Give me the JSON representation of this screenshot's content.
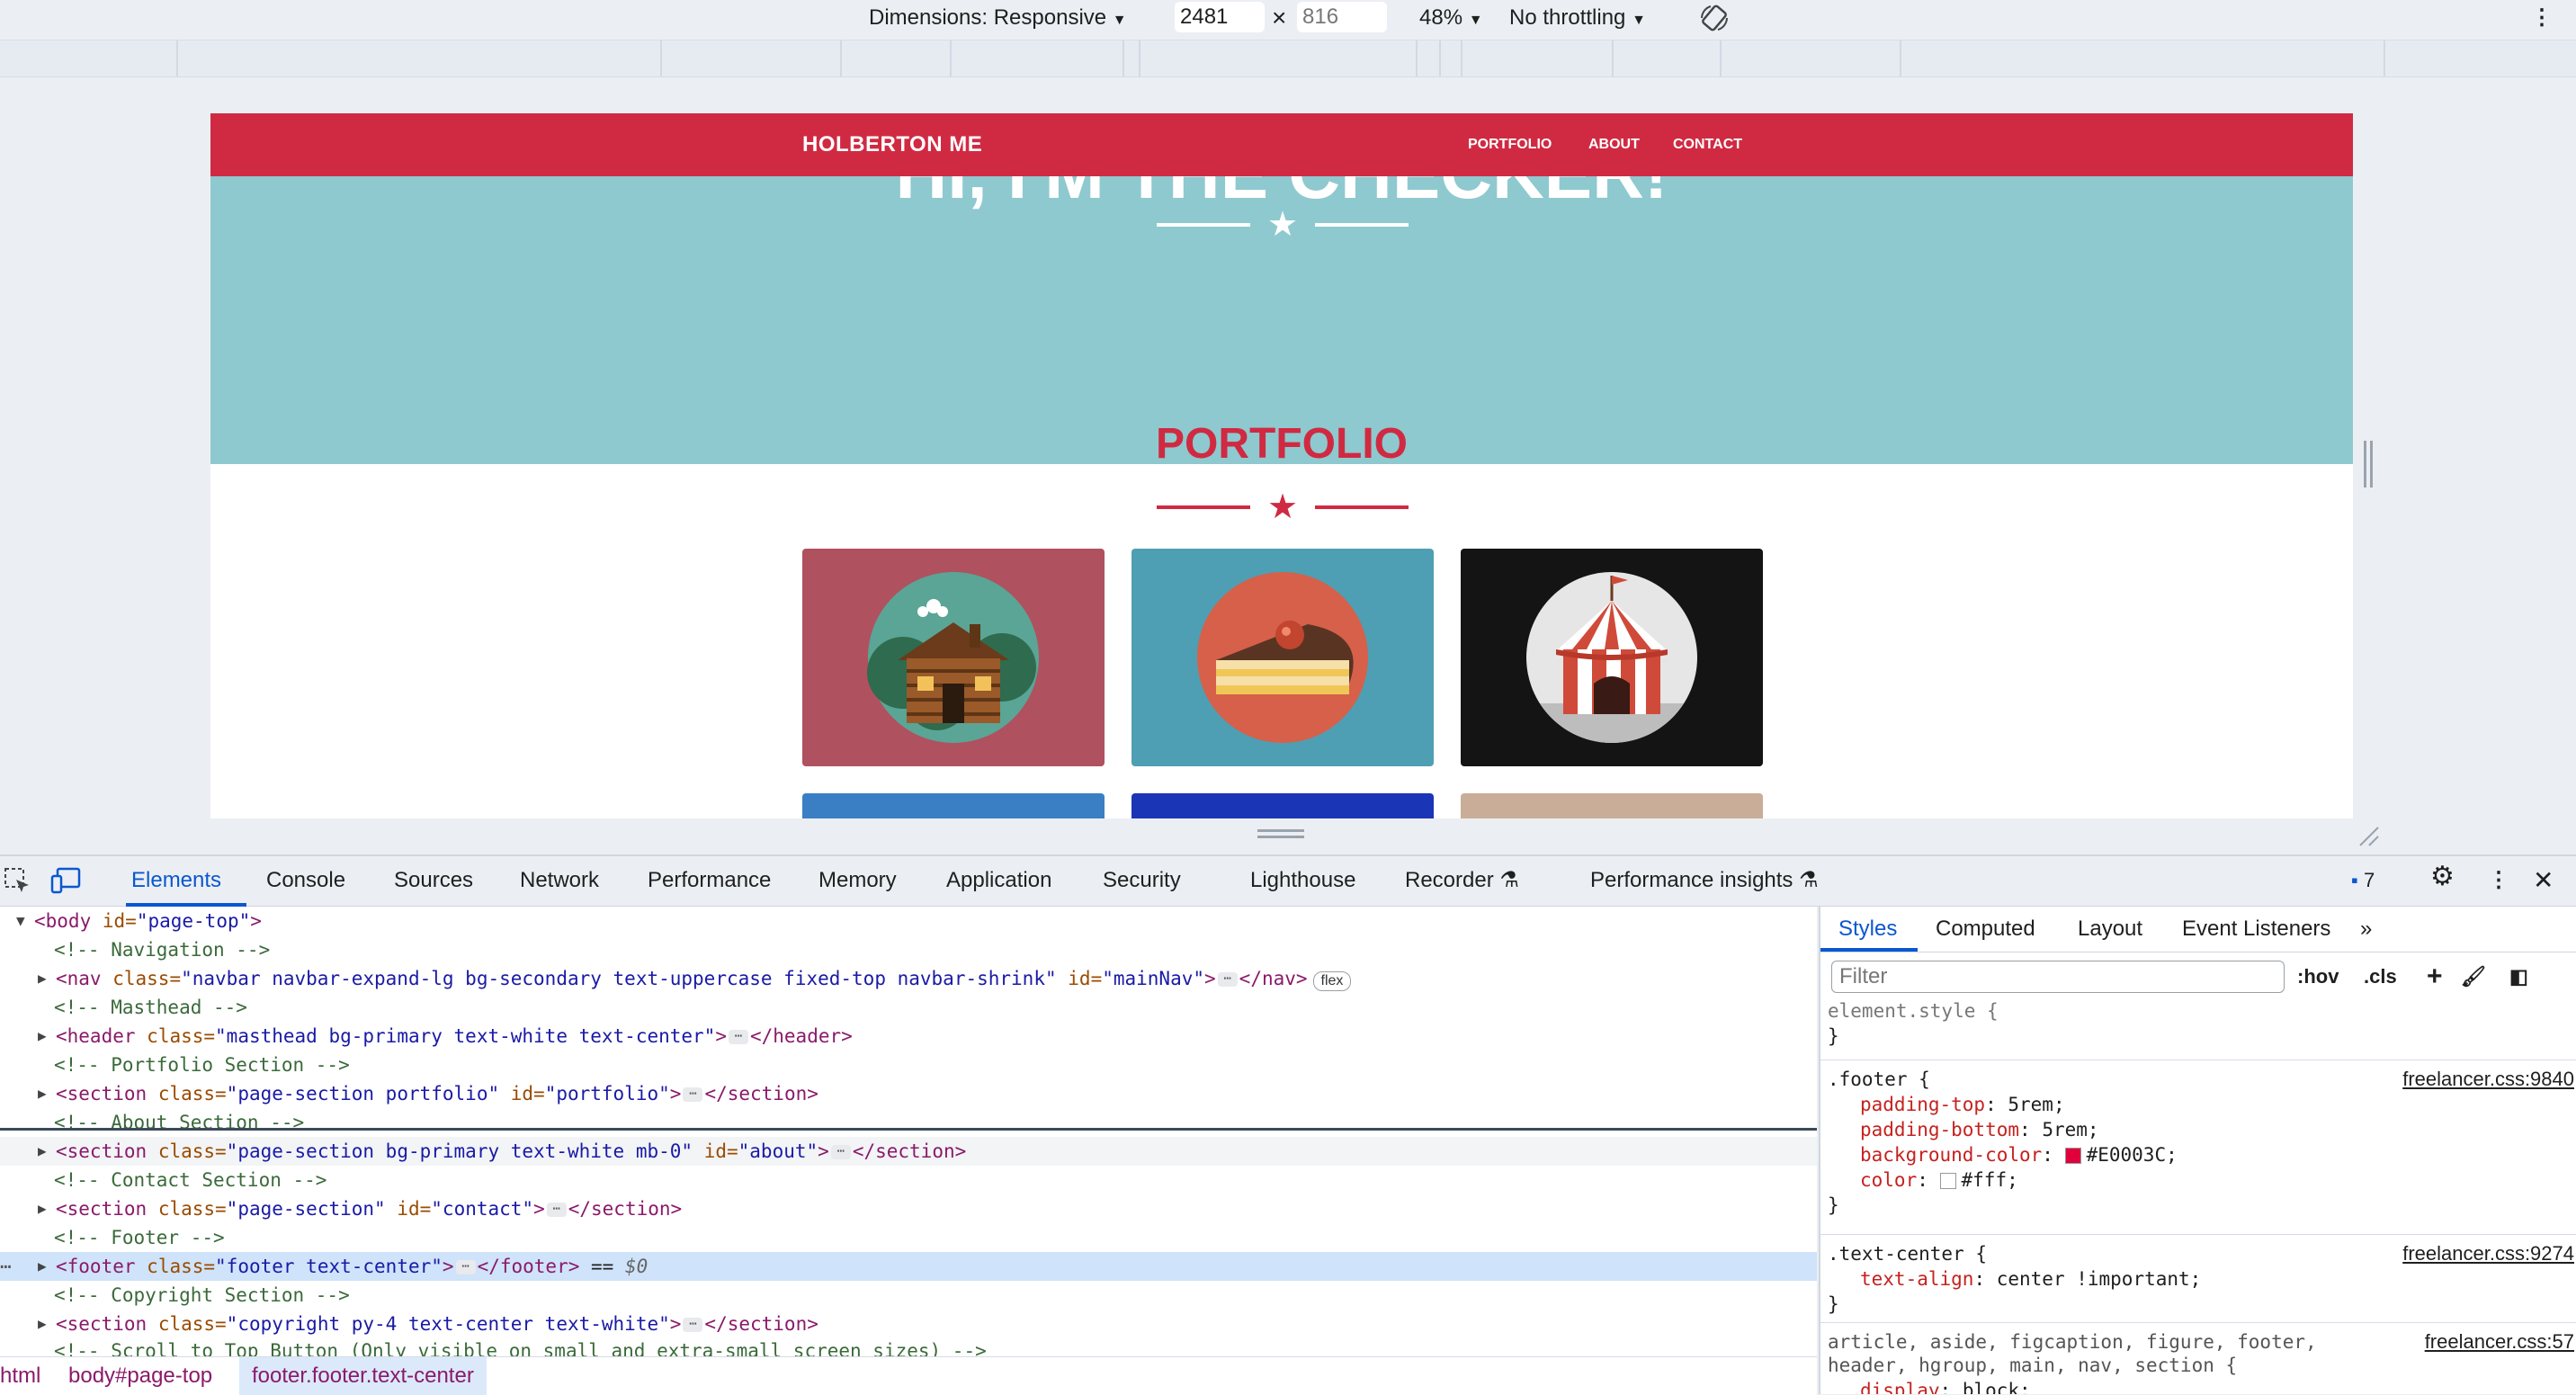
{
  "toolbar": {
    "dimensions_label": "Dimensions: Responsive",
    "width_value": "2481",
    "times": "×",
    "height_placeholder": "816",
    "zoom": "48%",
    "throttling": "No throttling"
  },
  "site": {
    "brand": "HOLBERTON ME",
    "nav": [
      "PORTFOLIO",
      "ABOUT",
      "CONTACT"
    ],
    "masthead_title": "HI, I'M THE CHECKER!",
    "portfolio_heading": "PORTFOLIO",
    "colors": {
      "primary": "#d02a42",
      "masthead": "#8ec9cf",
      "white": "#ffffff"
    },
    "cards": [
      {
        "name": "cabin",
        "bg": "#b0515f"
      },
      {
        "name": "cake",
        "bg": "#4e9fb3"
      },
      {
        "name": "circus",
        "bg": "#141414"
      }
    ],
    "cards_row2": [
      "#3a7fc4",
      "#1b35b7",
      "#c9ad98"
    ]
  },
  "devtools": {
    "tabs": [
      "Elements",
      "Console",
      "Sources",
      "Network",
      "Performance",
      "Memory",
      "Application",
      "Security",
      "Lighthouse",
      "Recorder",
      "Performance insights"
    ],
    "issues_count": "7",
    "dom": {
      "body_tag": "<body",
      "body_attr": "id=",
      "body_val": "\"page-top\"",
      "nav_comment": "<!-- Navigation -->",
      "nav_tag": "<nav",
      "nav_class_attr": "class=",
      "nav_class_val": "\"navbar navbar-expand-lg bg-secondary text-uppercase fixed-top navbar-shrink\"",
      "nav_id_attr": "id=",
      "nav_id_val": "\"mainNav\"",
      "nav_close": "</nav>",
      "flex_badge": "flex",
      "masthead_comment": "<!-- Masthead -->",
      "header_tag": "<header",
      "header_class_val": "\"masthead bg-primary text-white text-center\"",
      "header_close": "</header>",
      "portfolio_comment": "<!-- Portfolio Section -->",
      "section_tag": "<section",
      "portfolio_class_val": "\"page-section portfolio\"",
      "portfolio_id_val": "\"portfolio\"",
      "section_close": "</section>",
      "about_comment": "<!-- About Section -->",
      "about_class_val": "\"page-section bg-primary text-white mb-0\"",
      "about_id_val": "\"about\"",
      "contact_comment": "<!-- Contact Section -->",
      "contact_class_val": "\"page-section\"",
      "contact_id_val": "\"contact\"",
      "footer_comment": "<!-- Footer -->",
      "footer_tag": "<footer",
      "footer_class_val": "\"footer text-center\"",
      "footer_close": "</footer>",
      "footer_eq": "==",
      "footer_dollar": "$0",
      "copyright_comment": "<!-- Copyright Section -->",
      "copyright_class_val": "\"copyright py-4 text-center text-white\"",
      "scroll_comment": "<!-- Scroll to Top Button (Only visible on small and extra-small screen sizes) -->"
    },
    "breadcrumbs": [
      "html",
      "body#page-top",
      "footer.footer.text-center"
    ],
    "styles": {
      "tabs": [
        "Styles",
        "Computed",
        "Layout",
        "Event Listeners"
      ],
      "filter_placeholder": "Filter",
      "hov": ":hov",
      "cls": ".cls",
      "element_style": "element.style {",
      "close_brace": "}",
      "footer_selector": ".footer {",
      "footer_source": "freelancer.css:9840",
      "footer_props": [
        {
          "name": "padding-top",
          "value": "5rem;"
        },
        {
          "name": "padding-bottom",
          "value": "5rem;"
        },
        {
          "name": "background-color",
          "value": "#E0003C;",
          "swatch": "#E0003C"
        },
        {
          "name": "color",
          "value": "#fff;",
          "swatch": "#ffffff"
        }
      ],
      "text_center_selector": ".text-center {",
      "text_center_source": "freelancer.css:9274",
      "text_center_prop": "text-align",
      "text_center_value": "center !important;",
      "block_selector_1": "article, aside, figcaption, figure, footer,",
      "block_selector_2": "header, hgroup, main, nav, section {",
      "block_source": "freelancer.css:57",
      "block_prop": "display",
      "block_value": "block;"
    }
  }
}
